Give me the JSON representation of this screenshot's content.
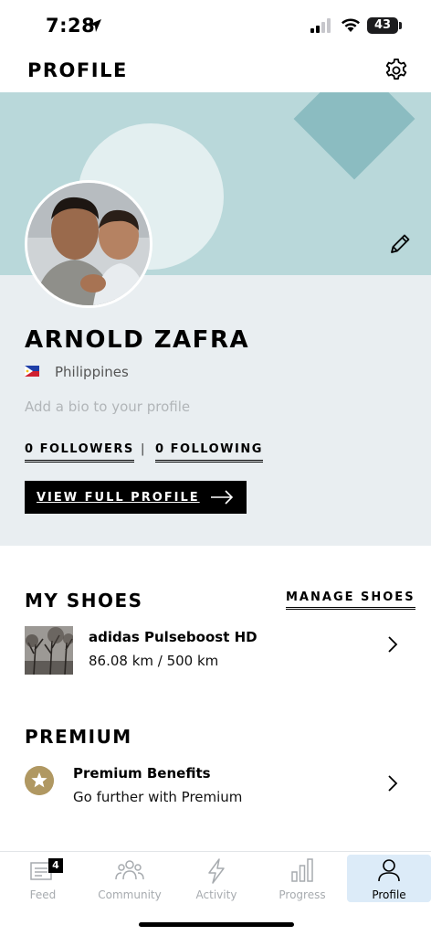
{
  "status_bar": {
    "time": "7:28",
    "battery": "43"
  },
  "header": {
    "title": "PROFILE"
  },
  "profile": {
    "name": "ARNOLD ZAFRA",
    "country": "Philippines",
    "bio_placeholder": "Add a bio to your profile",
    "followers_label": "0 FOLLOWERS",
    "separator": "|",
    "following_label": "0 FOLLOWING",
    "view_full_profile_label": "VIEW FULL PROFILE"
  },
  "shoes": {
    "title": "MY SHOES",
    "manage_label": "MANAGE SHOES",
    "items": [
      {
        "name": "adidas Pulseboost HD",
        "distance": "86.08 km / 500 km"
      }
    ]
  },
  "premium": {
    "title": "PREMIUM",
    "item_title": "Premium Benefits",
    "item_subtitle": "Go further with Premium"
  },
  "tab_bar": {
    "active": "Profile",
    "tabs": [
      {
        "label": "Feed",
        "icon": "feed-icon",
        "badge": "4"
      },
      {
        "label": "Community",
        "icon": "community-icon"
      },
      {
        "label": "Activity",
        "icon": "activity-icon"
      },
      {
        "label": "Progress",
        "icon": "progress-icon"
      },
      {
        "label": "Profile",
        "icon": "profile-icon"
      }
    ]
  },
  "colors": {
    "hero_bg": "#b9d8da",
    "hero_diamond": "#8bbcc1",
    "panel_bg": "#e9eef1",
    "premium_gold": "#b09862",
    "active_tab_bg": "#dcebf8"
  }
}
